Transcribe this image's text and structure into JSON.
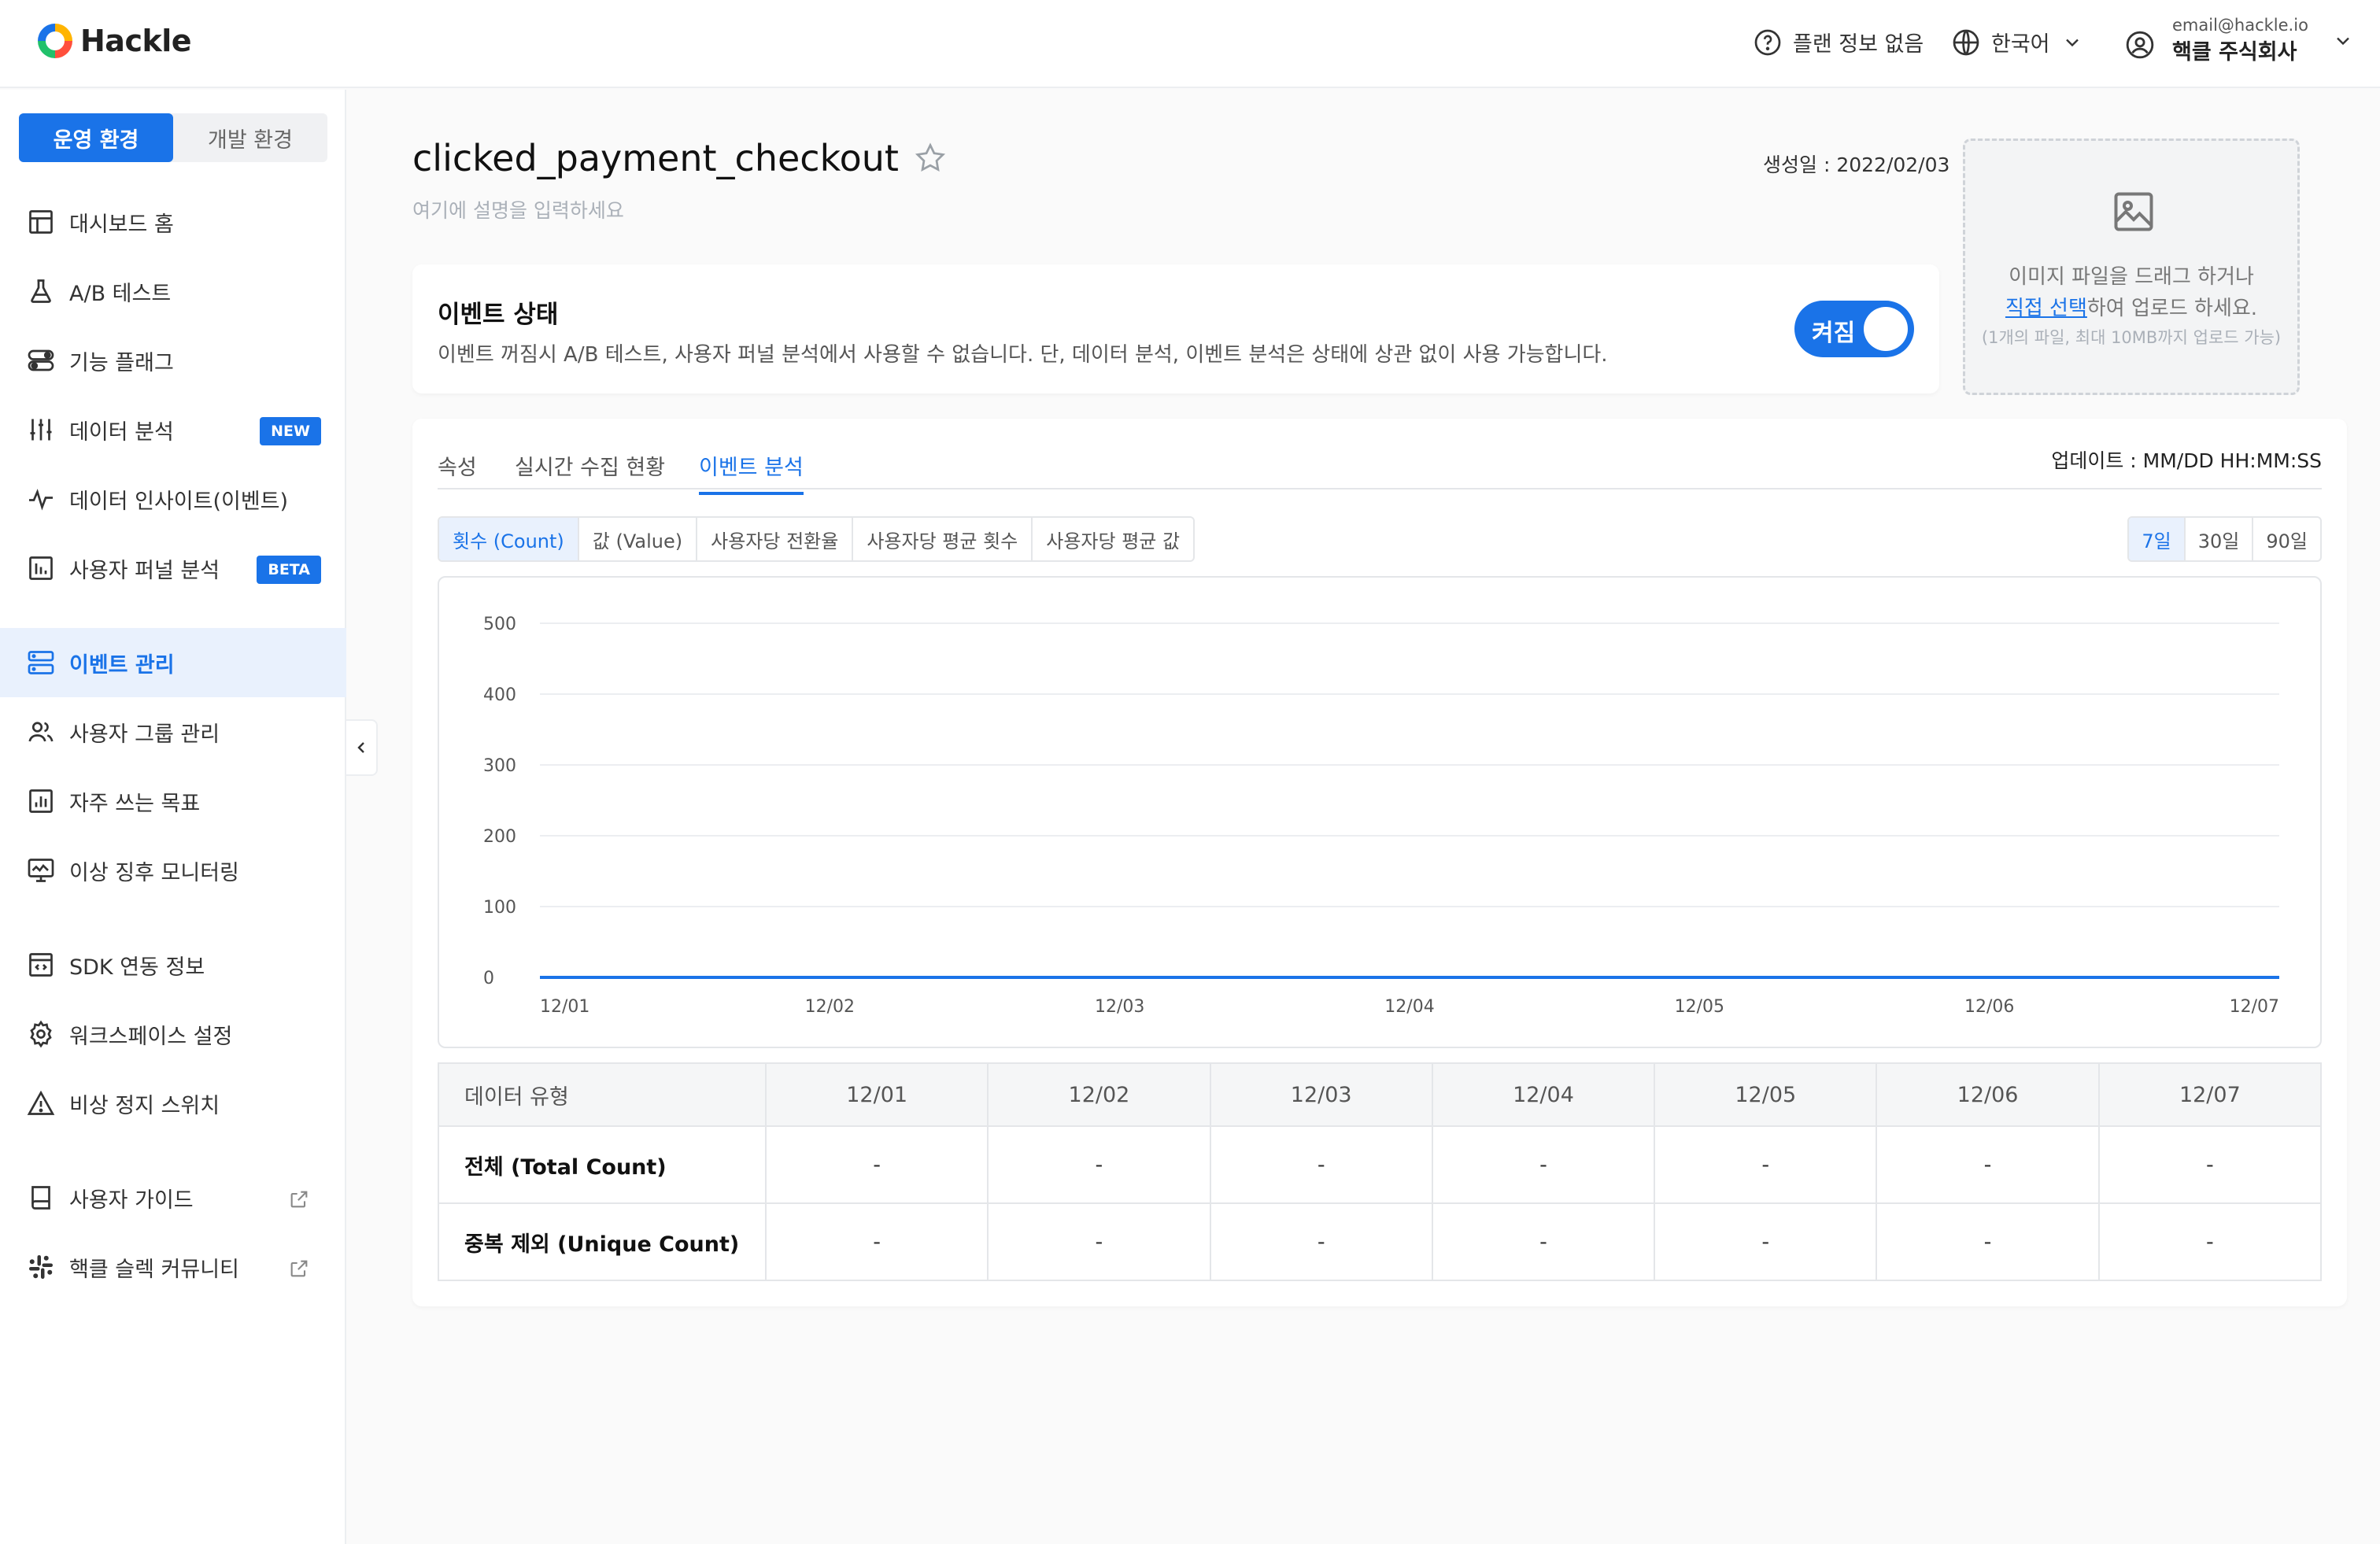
{
  "brand": {
    "name": "Hackle"
  },
  "header": {
    "plan_label": "플랜 정보 없음",
    "language": "한국어",
    "account_email": "email@hackle.io",
    "account_company": "핵클 주식회사"
  },
  "sidebar": {
    "env_prod": "운영 환경",
    "env_dev": "개발 환경",
    "items": [
      {
        "label": "대시보드 홈",
        "icon": "dashboard-icon"
      },
      {
        "label": "A/B 테스트",
        "icon": "flask-icon"
      },
      {
        "label": "기능 플래그",
        "icon": "toggle-icon"
      },
      {
        "label": "데이터 분석",
        "icon": "sliders-icon",
        "badge": "NEW"
      },
      {
        "label": "데이터 인사이트(이벤트)",
        "icon": "pulse-icon"
      },
      {
        "label": "사용자 퍼널 분석",
        "icon": "bar-chart-icon",
        "badge": "BETA"
      },
      {
        "label": "이벤트 관리",
        "icon": "server-icon",
        "active": true
      },
      {
        "label": "사용자 그룹 관리",
        "icon": "users-icon"
      },
      {
        "label": "자주 쓰는 목표",
        "icon": "chart-icon"
      },
      {
        "label": "이상 징후 모니터링",
        "icon": "monitor-icon"
      },
      {
        "label": "SDK 연동 정보",
        "icon": "code-icon"
      },
      {
        "label": "워크스페이스 설정",
        "icon": "gear-icon"
      },
      {
        "label": "비상 정지 스위치",
        "icon": "warning-icon"
      },
      {
        "label": "사용자 가이드",
        "icon": "book-icon"
      },
      {
        "label": "핵클 슬렉 커뮤니티",
        "icon": "slack-icon"
      }
    ]
  },
  "event": {
    "name": "clicked_payment_checkout",
    "description_placeholder": "여기에 설명을 입력하세요",
    "created": "생성일 : 2022/02/03"
  },
  "upload": {
    "line1": "이미지 파일을 드래그 하거나",
    "link": "직접 선택",
    "line2_rest": "하여 업로드 하세요.",
    "note": "(1개의 파일, 최대 10MB까지 업로드 가능)"
  },
  "status": {
    "title": "이벤트 상태",
    "description": "이벤트 꺼짐시 A/B 테스트, 사용자 퍼널 분석에서 사용할 수 없습니다. 단, 데이터 분석, 이벤트 분석은 상태에 상관 없이 사용 가능합니다.",
    "toggle_label": "켜짐",
    "toggle_color": "#1a73e8"
  },
  "tabs": [
    "속성",
    "실시간 수집 현황",
    "이벤트 분석"
  ],
  "active_tab": "이벤트 분석",
  "updated": "업데이트 : MM/DD HH:MM:SS",
  "metrics": [
    "횟수 (Count)",
    "값 (Value)",
    "사용자당 전환율",
    "사용자당 평균 횟수",
    "사용자당 평균 값"
  ],
  "ranges": [
    "7일",
    "30일",
    "90일"
  ],
  "chart_data": {
    "type": "line",
    "x": [
      "12/01",
      "12/02",
      "12/03",
      "12/04",
      "12/05",
      "12/06",
      "12/07"
    ],
    "series": [
      {
        "values": [
          0,
          0,
          0,
          0,
          0,
          0,
          0
        ]
      }
    ],
    "y_ticks": [
      0,
      100,
      200,
      300,
      400,
      500
    ],
    "ylim": [
      0,
      500
    ],
    "grid": true,
    "line_color": "#1a73e8"
  },
  "table": {
    "header_first": "데이터 유형",
    "dates": [
      "12/01",
      "12/02",
      "12/03",
      "12/04",
      "12/05",
      "12/06",
      "12/07"
    ],
    "rows": [
      {
        "label": "전체 (Total Count)",
        "values": [
          "-",
          "-",
          "-",
          "-",
          "-",
          "-",
          "-"
        ]
      },
      {
        "label": "중복 제외 (Unique Count)",
        "values": [
          "-",
          "-",
          "-",
          "-",
          "-",
          "-",
          "-"
        ]
      }
    ]
  }
}
